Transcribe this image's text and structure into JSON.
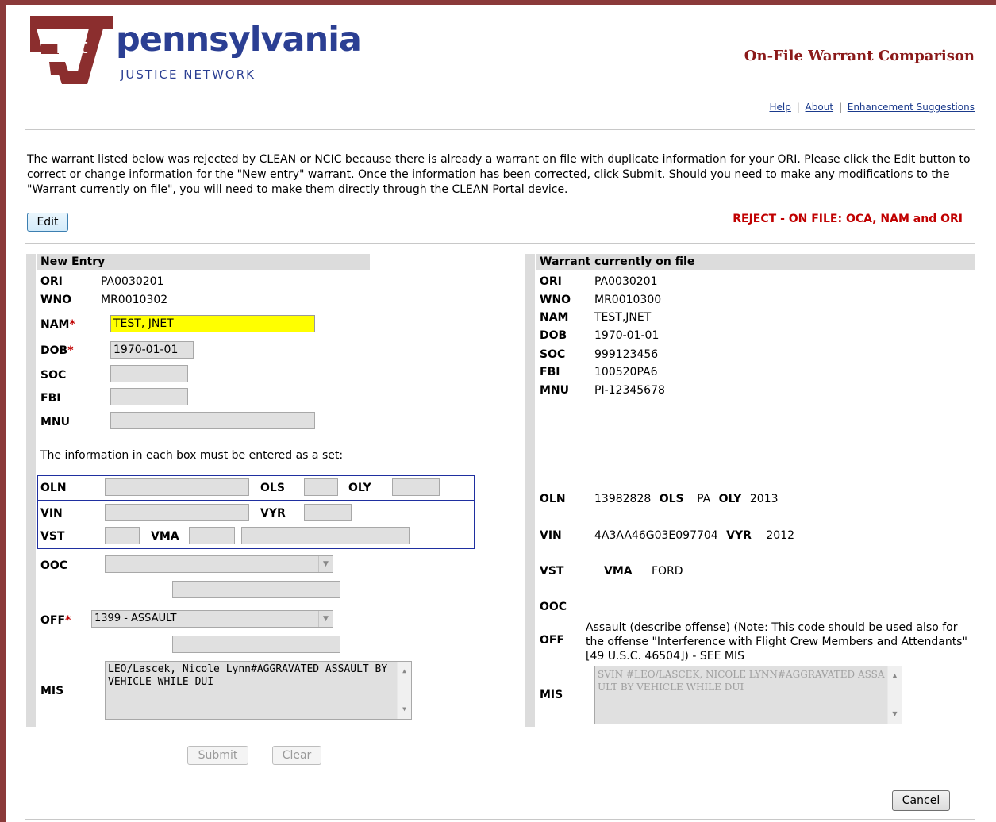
{
  "header": {
    "logo_mark_text": "net",
    "brand_name": "pennsylvania",
    "brand_sub": "JUSTICE NETWORK",
    "page_title": "On-File Warrant Comparison",
    "links": [
      "Help",
      "About",
      "Enhancement Suggestions"
    ],
    "separator": "|"
  },
  "intro_text": "The warrant listed below was rejected by CLEAN or NCIC because there is already a warrant on file with duplicate information for your ORI. Please click the Edit button to correct or change information for the \"New entry\" warrant. Once the information has been corrected, click Submit. Should you need to make any modifications to the \"Warrant currently on file\", you will need to make them directly through the CLEAN Portal device.",
  "edit_button": "Edit",
  "reject_message": "REJECT - ON FILE: OCA, NAM and ORI",
  "new_entry": {
    "heading": "New Entry",
    "labels": {
      "ori": "ORI",
      "wno": "WNO",
      "nam": "NAM",
      "dob": "DOB",
      "soc": "SOC",
      "fbi": "FBI",
      "mnu": "MNU",
      "oln": "OLN",
      "ols": "OLS",
      "oly": "OLY",
      "vin": "VIN",
      "vyr": "VYR",
      "vst": "VST",
      "vma": "VMA",
      "ooc": "OOC",
      "off": "OFF",
      "mis": "MIS"
    },
    "required_mark": "*",
    "ori": "PA0030201",
    "wno": "MR0010302",
    "nam": "TEST, JNET",
    "dob": "1970-01-01",
    "soc": "",
    "fbi": "",
    "mnu": "",
    "set_note": "The information in each box must be entered as a set:",
    "oln": "",
    "ols": "",
    "oly": "",
    "vin": "",
    "vyr": "",
    "vst": "",
    "vma": "",
    "vma_desc": "",
    "ooc_selected": "",
    "ooc_extra": "",
    "off_selected": "1399 - ASSAULT",
    "off_extra": "",
    "mis": "LEO/Lascek, Nicole Lynn#AGGRAVATED ASSAULT BY VEHICLE WHILE DUI"
  },
  "on_file": {
    "heading": "Warrant currently on file",
    "ori": "PA0030201",
    "wno": "MR0010300",
    "nam": "TEST,JNET",
    "dob": "1970-01-01",
    "soc": "999123456",
    "fbi": "100520PA6",
    "mnu": "PI-12345678",
    "oln": "13982828",
    "ols": "PA",
    "oly": "2013",
    "vin": "4A3AA46G03E097704",
    "vyr": "2012",
    "vst": "",
    "vma": "FORD",
    "ooc": "",
    "off_description": "Assault (describe offense) (Note: This code should be used also for the offense \"Interference with Flight Crew Members and Attendants\" [49 U.S.C. 46504]) - SEE MIS",
    "mis": "SVIN #LEO/LASCEK, NICOLE LYNN#AGGRAVATED ASSAULT BY VEHICLE WHILE DUI"
  },
  "buttons": {
    "submit": "Submit",
    "clear": "Clear",
    "cancel": "Cancel"
  },
  "colors": {
    "frame": "#8b3a3a",
    "brand": "#2b3f93",
    "title": "#8b1a1a",
    "reject": "#c00000",
    "highlight": "#ffff00",
    "set_box": "#1f2fa0"
  }
}
